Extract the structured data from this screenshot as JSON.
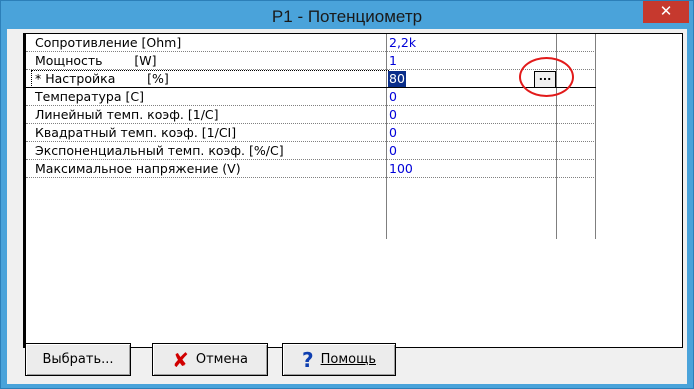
{
  "window": {
    "title": "P1 - Потенциометр",
    "close_glyph": "✕"
  },
  "properties": [
    {
      "name": "Сопротивление [Ohm]",
      "value": "2,2k"
    },
    {
      "name": "Мощность        [W]",
      "value": "1"
    },
    {
      "name": "* Настройка        [%]",
      "value": "80",
      "selected": true
    },
    {
      "name": "Температура [C]",
      "value": "0"
    },
    {
      "name": "Линейный темп. коэф. [1/C]",
      "value": "0"
    },
    {
      "name": "Квадратный темп. коэф. [1/CI]",
      "value": "0"
    },
    {
      "name": "Экспоненциальный темп. коэф. [%/C]",
      "value": "0"
    },
    {
      "name": "Максимальное напряжение (V)",
      "value": "100"
    }
  ],
  "editor_button_label": "...",
  "buttons": {
    "select_label": "Выбрать...",
    "cancel_label": "Отмена",
    "help_label": "Помощь",
    "cancel_icon": "cross-icon",
    "help_icon": "question-icon"
  },
  "colors": {
    "value_text": "#0000d8",
    "selection_bg": "#0a2e8a",
    "annotation_circle": "#e21a1a",
    "titlebar": "#4aa3da"
  }
}
